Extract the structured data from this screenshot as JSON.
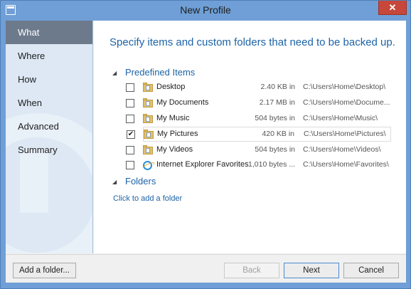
{
  "window": {
    "title": "New Profile",
    "close_label": "✕"
  },
  "sidebar": {
    "items": [
      {
        "label": "What",
        "active": true
      },
      {
        "label": "Where",
        "active": false
      },
      {
        "label": "How",
        "active": false
      },
      {
        "label": "When",
        "active": false
      },
      {
        "label": "Advanced",
        "active": false
      },
      {
        "label": "Summary",
        "active": false
      }
    ]
  },
  "main": {
    "heading": "Specify items and custom folders that need to be backed up.",
    "predefined_group": {
      "label": "Predefined Items",
      "toggle": "◢",
      "items": [
        {
          "name": "Desktop",
          "size": "2.40 KB in",
          "path": "C:\\Users\\Home\\Desktop\\",
          "checked": false,
          "icon": "folder-icon"
        },
        {
          "name": "My Documents",
          "size": "2.17 MB in",
          "path": "C:\\Users\\Home\\Docume...",
          "checked": false,
          "icon": "documents-folder-icon"
        },
        {
          "name": "My Music",
          "size": "504 bytes in",
          "path": "C:\\Users\\Home\\Music\\",
          "checked": false,
          "icon": "music-folder-icon"
        },
        {
          "name": "My Pictures",
          "size": "420 KB in",
          "path": "C:\\Users\\Home\\Pictures\\",
          "checked": true,
          "icon": "pictures-folder-icon"
        },
        {
          "name": "My Videos",
          "size": "504 bytes in",
          "path": "C:\\Users\\Home\\Videos\\",
          "checked": false,
          "icon": "videos-folder-icon"
        },
        {
          "name": "Internet Explorer Favorites",
          "size": "1,010 bytes ...",
          "path": "C:\\Users\\Home\\Favorites\\",
          "checked": false,
          "icon": "internet-explorer-icon"
        }
      ]
    },
    "folders_group": {
      "label": "Folders",
      "toggle": "◢"
    },
    "add_folder_link": "Click to add a folder"
  },
  "footer": {
    "add_folder_button": "Add a folder...",
    "back_button": "Back",
    "next_button": "Next",
    "cancel_button": "Cancel"
  },
  "colors": {
    "accent": "#1c63a6",
    "titlebar": "#6f9fd6",
    "close": "#c7473a",
    "sidebar_active": "#6c7a8c"
  }
}
